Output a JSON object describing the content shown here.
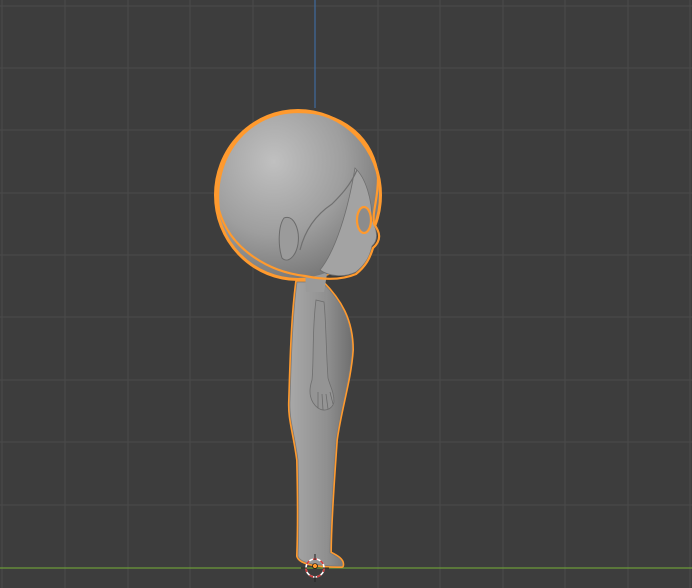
{
  "viewport": {
    "view": "side-orthographic",
    "background_color": "#3d3d3d",
    "grid_color": "#4a4a4a",
    "horizon_axis_color": "#6b9a3a",
    "vertical_axis_color": "#3f6c9e",
    "selection_outline_color": "#ff9a2e",
    "model_color": "#8a8a8a",
    "cursor_colors": [
      "#d23b3b",
      "#ffffff"
    ]
  },
  "scene": {
    "object": "character-model",
    "selected": true
  }
}
